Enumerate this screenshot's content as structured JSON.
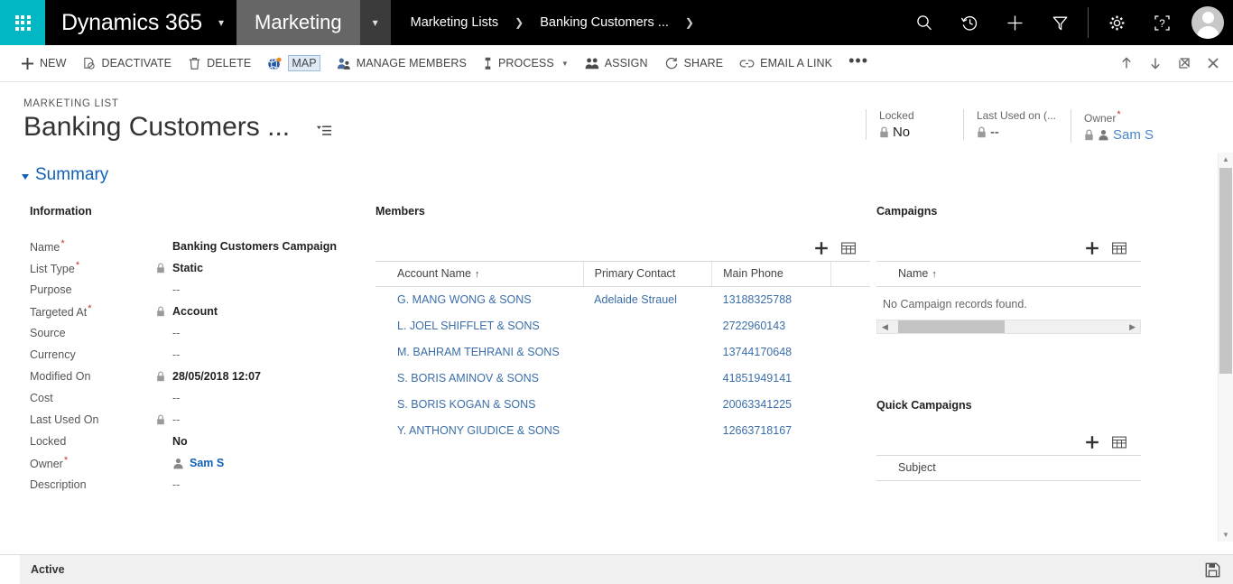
{
  "navbar": {
    "waffle_icon": "app-launcher-waffle-icon",
    "brand": "Dynamics 365",
    "app_tab": "Marketing",
    "breadcrumb": [
      {
        "label": "Marketing Lists"
      },
      {
        "label": "Banking Customers ..."
      }
    ],
    "icons": [
      {
        "name": "search-icon"
      },
      {
        "name": "recent-history-icon"
      },
      {
        "name": "quick-create-plus-icon"
      },
      {
        "name": "advanced-find-filter-icon"
      },
      {
        "name": "settings-gear-icon"
      },
      {
        "name": "help-question-icon"
      }
    ]
  },
  "commandbar": {
    "items": [
      {
        "label": "NEW",
        "icon": "plus-icon",
        "focused": false
      },
      {
        "label": "DEACTIVATE",
        "icon": "deactivate-icon",
        "focused": false
      },
      {
        "label": "DELETE",
        "icon": "trash-icon",
        "focused": false
      },
      {
        "label": "MAP",
        "icon": "globe-map-icon",
        "focused": true
      },
      {
        "label": "MANAGE MEMBERS",
        "icon": "people-icon",
        "focused": false
      },
      {
        "label": "PROCESS",
        "icon": "process-icon",
        "focused": false,
        "has_caret": true
      },
      {
        "label": "ASSIGN",
        "icon": "assign-people-icon",
        "focused": false
      },
      {
        "label": "SHARE",
        "icon": "share-icon",
        "focused": false
      },
      {
        "label": "EMAIL A LINK",
        "icon": "link-icon",
        "focused": false
      }
    ],
    "overflow_label": "•••",
    "right_icons": [
      {
        "name": "previous-record-up-icon"
      },
      {
        "name": "next-record-down-icon"
      },
      {
        "name": "popout-window-icon"
      },
      {
        "name": "close-icon"
      }
    ]
  },
  "record": {
    "entity_label": "MARKETING LIST",
    "title": "Banking Customers ...",
    "title_menu_icon": "record-set-menu-icon",
    "header_fields": [
      {
        "label": "Locked",
        "value": "No",
        "locked": true,
        "required": false,
        "is_link": false
      },
      {
        "label": "Last Used on (...",
        "value": "--",
        "locked": true,
        "required": false,
        "is_link": false
      },
      {
        "label": "Owner",
        "value": "Sam S",
        "locked": true,
        "required": true,
        "is_link": true,
        "has_person_icon": true
      }
    ]
  },
  "summary": {
    "label": "Summary"
  },
  "information": {
    "section_title": "Information",
    "fields": [
      {
        "label": "Name",
        "required": true,
        "locked": false,
        "value": "Banking Customers Campaign",
        "dim": false
      },
      {
        "label": "List Type",
        "required": true,
        "locked": true,
        "value": "Static",
        "dim": false
      },
      {
        "label": "Purpose",
        "required": false,
        "locked": false,
        "value": "--",
        "dim": true
      },
      {
        "label": "Targeted At",
        "required": true,
        "locked": true,
        "value": "Account",
        "dim": false
      },
      {
        "label": "Source",
        "required": false,
        "locked": false,
        "value": "--",
        "dim": true
      },
      {
        "label": "Currency",
        "required": false,
        "locked": false,
        "value": "--",
        "dim": true
      },
      {
        "label": "Modified On",
        "required": false,
        "locked": true,
        "value": "28/05/2018  12:07",
        "dim": false
      },
      {
        "label": "Cost",
        "required": false,
        "locked": false,
        "value": "--",
        "dim": true
      },
      {
        "label": "Last Used On",
        "required": false,
        "locked": true,
        "value": "--",
        "dim": true
      },
      {
        "label": "Locked",
        "required": false,
        "locked": false,
        "value": "No",
        "dim": false
      },
      {
        "label": "Owner",
        "required": true,
        "locked": false,
        "value": "Sam S",
        "dim": false,
        "is_link": true,
        "has_person_icon": true
      },
      {
        "label": "Description",
        "required": false,
        "locked": false,
        "value": "--",
        "dim": true
      }
    ]
  },
  "members": {
    "section_title": "Members",
    "add_icon": "add-plus-icon",
    "lookup_icon": "open-grid-icon",
    "columns": [
      {
        "label": "Account Name",
        "sorted": true,
        "sort_arrow": "↑"
      },
      {
        "label": "Primary Contact",
        "sorted": false,
        "sort_arrow": ""
      },
      {
        "label": "Main Phone",
        "sorted": false,
        "sort_arrow": ""
      },
      {
        "label": "",
        "sorted": false,
        "sort_arrow": ""
      }
    ],
    "rows": [
      {
        "account_name": "G. MANG WONG & SONS",
        "primary_contact": "Adelaide Strauel",
        "main_phone": "13188325788"
      },
      {
        "account_name": "L. JOEL SHIFFLET & SONS",
        "primary_contact": "",
        "main_phone": "2722960143"
      },
      {
        "account_name": "M. BAHRAM TEHRANI & SONS",
        "primary_contact": "",
        "main_phone": "13744170648"
      },
      {
        "account_name": "S. BORIS AMINOV & SONS",
        "primary_contact": "",
        "main_phone": "41851949141"
      },
      {
        "account_name": "S. BORIS KOGAN & SONS",
        "primary_contact": "",
        "main_phone": "20063341225"
      },
      {
        "account_name": "Y. ANTHONY GIUDICE & SONS",
        "primary_contact": "",
        "main_phone": "12663718167"
      }
    ]
  },
  "campaigns": {
    "section_title": "Campaigns",
    "add_icon": "add-plus-icon",
    "lookup_icon": "open-grid-icon",
    "column_name": "Name",
    "sort_arrow": "↑",
    "empty_message": "No Campaign records found.",
    "scrollbar": {
      "left_arrow": "◀",
      "right_arrow": "▶"
    }
  },
  "quick_campaigns": {
    "section_title": "Quick Campaigns",
    "add_icon": "add-plus-icon",
    "lookup_icon": "open-grid-icon",
    "column_subject": "Subject"
  },
  "footer": {
    "status": "Active",
    "save_icon": "save-floppy-icon"
  },
  "colors": {
    "brand_teal": "#00b7c3",
    "nav_black": "#000000",
    "app_tab_gray": "#666666",
    "link_blue": "#1160b7",
    "grid_link_blue": "#3b6ea8",
    "required_red": "#c0392b"
  }
}
